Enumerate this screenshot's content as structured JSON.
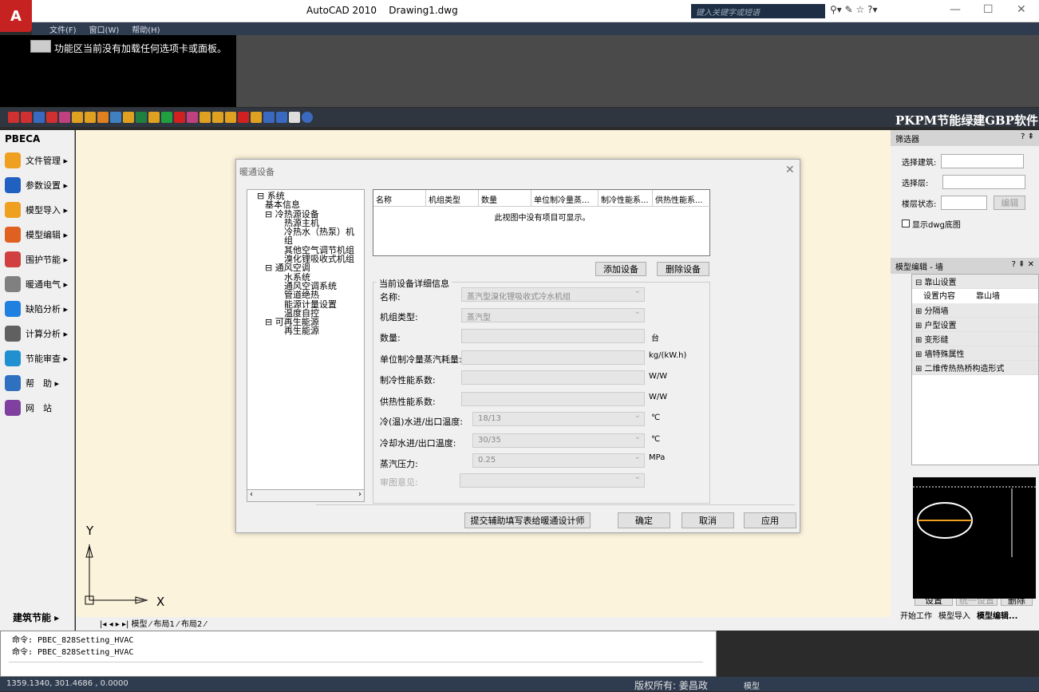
{
  "app": {
    "title": "AutoCAD 2010    Drawing1.dwg",
    "search_placeholder": "键入关键字或短语",
    "menu": [
      "文件(F)",
      "窗口(W)",
      "帮助(H)"
    ],
    "ribbon_message": "功能区当前没有加载任何选项卡或面板。",
    "brand": "PKPM节能绿建GBP软件"
  },
  "left_panel": {
    "title": "PBECA",
    "items": [
      {
        "label": "文件管理 ▸",
        "color": "#f0a020"
      },
      {
        "label": "参数设置 ▸",
        "color": "#2060c0"
      },
      {
        "label": "模型导入 ▸",
        "color": "#f0a020"
      },
      {
        "label": "模型编辑 ▸",
        "color": "#e06020"
      },
      {
        "label": "围护节能 ▸",
        "color": "#d04040"
      },
      {
        "label": "暖通电气 ▸",
        "color": "#808080"
      },
      {
        "label": "缺陷分析 ▸",
        "color": "#2080e0"
      },
      {
        "label": "计算分析 ▸",
        "color": "#606060"
      },
      {
        "label": "节能审查 ▸",
        "color": "#2090d0"
      },
      {
        "label": "帮　助 ▸",
        "color": "#3070c0"
      },
      {
        "label": "网　站",
        "color": "#8040a0"
      }
    ],
    "footer": "建筑节能 ▸"
  },
  "drawing": {
    "tabs": "|◂ ◂ ▸ ▸| 模型 ⁄ 布局1 ⁄ 布局2 ⁄",
    "ucs_y": "Y",
    "ucs_x": "X"
  },
  "command": {
    "lines": [
      "命令: PBEC_828Setting_HVAC",
      "命令: PBEC_828Setting_HVAC"
    ]
  },
  "status": {
    "coords": "1359.1340, 301.4686 , 0.0000",
    "copyright": "版权所有: 姜昌政",
    "model": "模型"
  },
  "right_panel": {
    "filter_title": "筛选器",
    "building_label": "选择建筑:",
    "floor_label": "选择层:",
    "floor_state_label": "楼层状态:",
    "edit_btn": "编辑",
    "show_dwg": "显示dwg底图",
    "model_edit_title": "模型编辑 - 墙",
    "tree": [
      {
        "label": "⊟ 靠山设置"
      },
      {
        "label": "⊞ 分隔墙"
      },
      {
        "label": "⊞ 户型设置"
      },
      {
        "label": "⊞ 变形缝"
      },
      {
        "label": "⊞ 墙特殊属性"
      },
      {
        "label": "⊞ 二维传热热桥构造形式"
      }
    ],
    "setting_key": "设置内容",
    "setting_val": "靠山墙",
    "btn_set": "设置",
    "btn_unify": "统一设置",
    "btn_delete": "删除",
    "bottom_tabs": [
      "开始工作",
      "模型导入",
      "模型编辑..."
    ]
  },
  "dialog": {
    "title": "暖通设备",
    "tree": [
      {
        "text": "⊟ 系统",
        "lvl": 1
      },
      {
        "text": "基本信息",
        "lvl": 2
      },
      {
        "text": "⊟ 冷热源设备",
        "lvl": 2
      },
      {
        "text": "热源主机",
        "lvl": 3
      },
      {
        "text": "冷热水（热泵）机组",
        "lvl": 3
      },
      {
        "text": "其他空气调节机组",
        "lvl": 3
      },
      {
        "text": "溴化锂吸收式机组",
        "lvl": 3
      },
      {
        "text": "⊟ 通风空调",
        "lvl": 2
      },
      {
        "text": "水系统",
        "lvl": 3
      },
      {
        "text": "通风空调系统",
        "lvl": 3
      },
      {
        "text": "管道绝热",
        "lvl": 3
      },
      {
        "text": "能源计量设置",
        "lvl": 3
      },
      {
        "text": "温度自控",
        "lvl": 3
      },
      {
        "text": "⊟ 可再生能源",
        "lvl": 2
      },
      {
        "text": "再生能源",
        "lvl": 3
      }
    ],
    "table_headers": [
      "名称",
      "机组类型",
      "数量",
      "单位制冷量蒸...",
      "制冷性能系...",
      "供热性能系..."
    ],
    "table_empty": "此视图中没有项目可显示。",
    "add_btn": "添加设备",
    "delete_btn": "删除设备",
    "detail_title": "当前设备详细信息",
    "fields": {
      "name_label": "名称:",
      "name_value": "蒸汽型溴化锂吸收式冷水机组",
      "type_label": "机组类型:",
      "type_value": "蒸汽型",
      "qty_label": "数量:",
      "qty_unit": "台",
      "steam_label": "单位制冷量蒸汽耗量:",
      "steam_unit": "kg/(kW.h)",
      "cop_cool_label": "制冷性能系数:",
      "cop_cool_unit": "W/W",
      "cop_heat_label": "供热性能系数:",
      "cop_heat_unit": "W/W",
      "chw_label": "冷(温)水进/出口温度:",
      "chw_value": "18/13",
      "chw_unit": "℃",
      "cw_label": "冷却水进/出口温度:",
      "cw_value": "30/35",
      "cw_unit": "℃",
      "press_label": "蒸汽压力:",
      "press_value": "0.25",
      "press_unit": "MPa",
      "review_label": "审图意见:"
    },
    "submit_btn": "提交辅助填写表给暖通设计师",
    "ok_btn": "确定",
    "cancel_btn": "取消",
    "apply_btn": "应用"
  }
}
